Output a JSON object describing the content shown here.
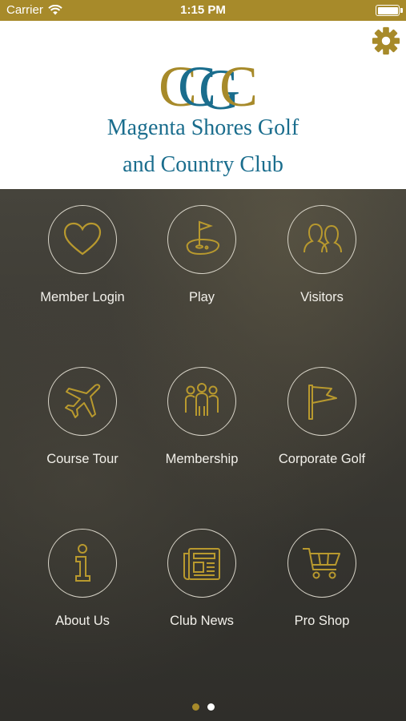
{
  "status_bar": {
    "carrier": "Carrier",
    "time": "1:15 PM",
    "battery_level": 1.0
  },
  "header": {
    "logo_letters": "CCGC",
    "club_name_line1": "Magenta Shores Golf",
    "club_name_line2": "and Country Club",
    "settings_icon": "gear-icon"
  },
  "tiles": [
    {
      "label": "Member Login",
      "icon": "heart-icon"
    },
    {
      "label": "Play",
      "icon": "golf-flag-green-icon"
    },
    {
      "label": "Visitors",
      "icon": "people-icon"
    },
    {
      "label": "Course Tour",
      "icon": "airplane-icon"
    },
    {
      "label": "Membership",
      "icon": "group-icon"
    },
    {
      "label": "Corporate Golf",
      "icon": "flag-icon"
    },
    {
      "label": "About Us",
      "icon": "info-icon"
    },
    {
      "label": "Club News",
      "icon": "newspaper-icon"
    },
    {
      "label": "Pro Shop",
      "icon": "cart-icon"
    }
  ],
  "pager": {
    "pages": 2,
    "current": 1
  },
  "colors": {
    "accent": "#a78a2a",
    "icon": "#b8992e",
    "brand_blue": "#1a6d8d",
    "page_dot_inactive": "#ffffff"
  }
}
